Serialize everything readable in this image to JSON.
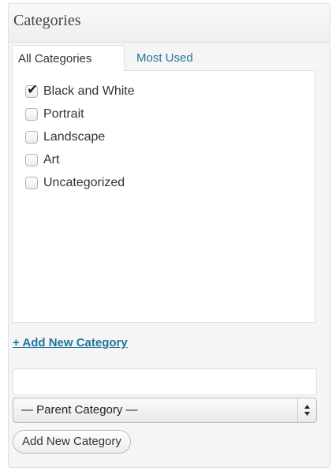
{
  "panel": {
    "title": "Categories"
  },
  "tabs": [
    {
      "label": "All Categories",
      "active": true
    },
    {
      "label": "Most Used",
      "active": false
    }
  ],
  "categories": [
    {
      "label": "Black and White",
      "checked": true
    },
    {
      "label": "Portrait",
      "checked": false
    },
    {
      "label": "Landscape",
      "checked": false
    },
    {
      "label": "Art",
      "checked": false
    },
    {
      "label": "Uncategorized",
      "checked": false
    }
  ],
  "add_new": {
    "link_label": "+ Add New Category",
    "input_value": "",
    "input_placeholder": "",
    "parent_select_value": "— Parent Category —",
    "button_label": "Add New Category"
  },
  "icons": {
    "check": "checkmark-icon",
    "select_arrows": "up-down-arrows-icon"
  },
  "colors": {
    "link": "#21759b",
    "panel_bg": "#f5f5f5",
    "border": "#dfdfdf"
  }
}
